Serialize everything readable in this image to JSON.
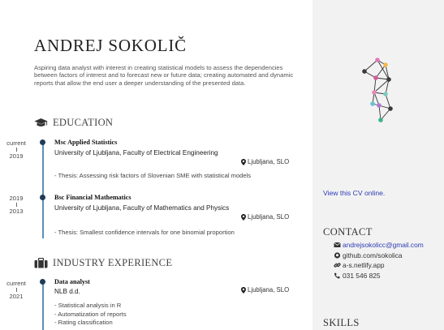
{
  "name": "ANDREJ SOKOLIČ",
  "intro": "Aspiring data analyst with interest in creating statistical models to assess the dependencies between factors of interest and to forecast new or future data; creating automated and dynamic reports that allow the end user a deeper understanding of the presented data.",
  "education": {
    "title": "EDUCATION",
    "entries": [
      {
        "date_end": "current",
        "date_start": "2019",
        "title": "Msc Applied Statistics",
        "org": "University of Ljubljana, Faculty of Electrical Engineering",
        "location": "Ljubljana, SLO",
        "detail": "- Thesis: Assessing risk factors of Slovenian SME with statistical models"
      },
      {
        "date_end": "2019",
        "date_start": "2013",
        "title": "Bsc Financial Mathematics",
        "org": "University of Ljubljana, Faculty of Mathematics and Physics",
        "location": "Ljubljana, SLO",
        "detail": "- Thesis: Smallest confidence intervals for one binomial proportion"
      }
    ]
  },
  "experience": {
    "title": "INDUSTRY EXPERIENCE",
    "entries": [
      {
        "date_end": "current",
        "date_start": "2021",
        "title": "Data analyst",
        "org": "NLB d.d.",
        "location": "Ljubljana, SLO",
        "details": [
          "- Statistical analysis in R",
          "- Automatization of reports",
          "- Rating classification"
        ]
      }
    ]
  },
  "sidebar": {
    "view_online": "View this CV online.",
    "contact_title": "CONTACT",
    "contacts": [
      {
        "icon": "envelope-icon",
        "text": "andrejsokolicc@gmail.com"
      },
      {
        "icon": "github-icon",
        "text": "github.com/sokolica"
      },
      {
        "icon": "link-icon",
        "text": "a-s.netlify.app"
      },
      {
        "icon": "phone-icon",
        "text": "031 546 825"
      }
    ],
    "skills_title": "SKILLS"
  },
  "colors": {
    "timeline": "#5b8fb8",
    "dot": "#1f3b58",
    "link": "#2d3cb4",
    "sidebar_bg": "#f2f2f2"
  }
}
